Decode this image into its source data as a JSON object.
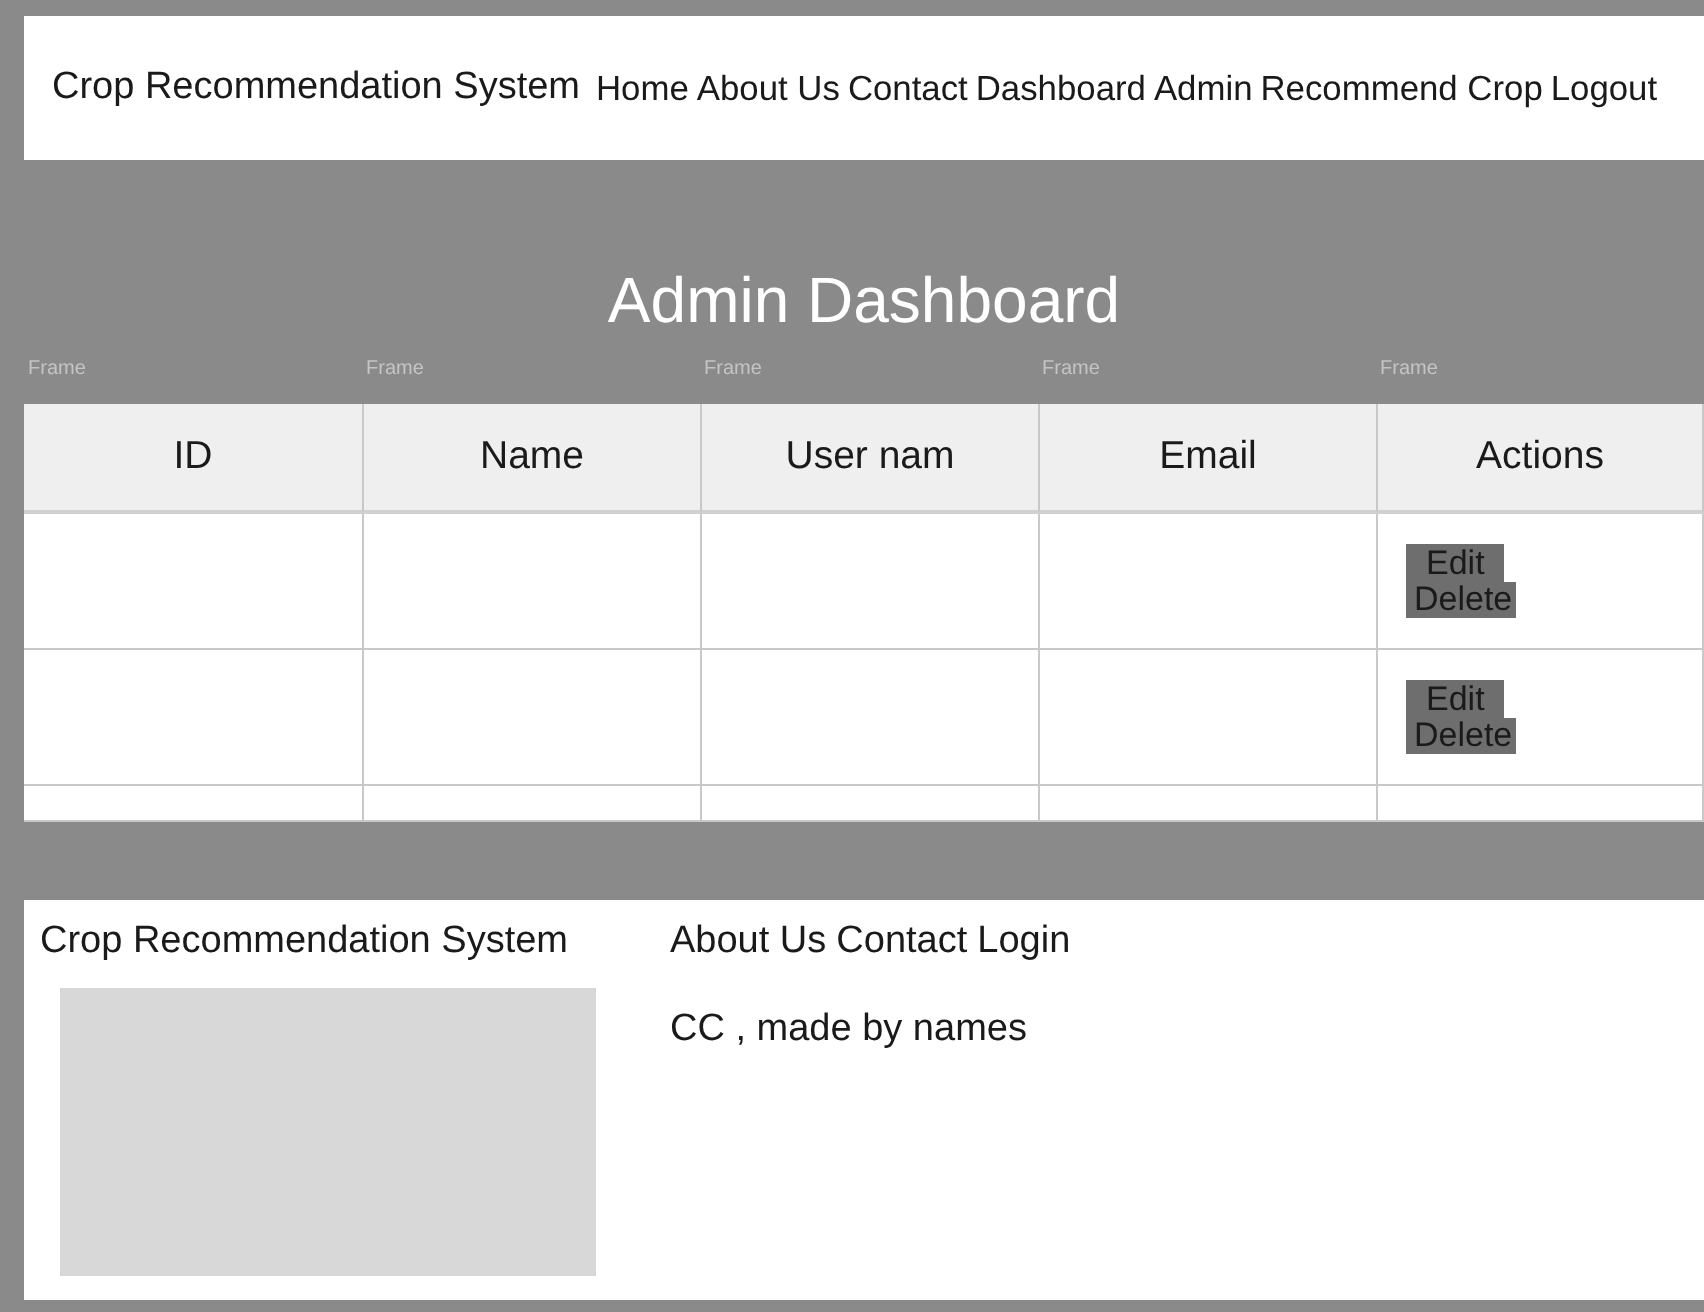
{
  "header": {
    "brand": "Crop Recommendation System",
    "nav": [
      "Home",
      "About Us",
      "Contact",
      "Dashboard",
      "Admin",
      "Recommend Crop",
      "Logout"
    ]
  },
  "title": "Admin Dashboard",
  "frame_labels": [
    "Frame",
    "Frame",
    "Frame",
    "Frame",
    "Frame"
  ],
  "table": {
    "columns": [
      "ID",
      "Name",
      "User nam",
      "Email",
      "Actions"
    ],
    "rows": [
      {
        "actions": [
          "Edit",
          "Delete"
        ]
      },
      {
        "actions": [
          "Edit",
          "Delete"
        ]
      },
      {}
    ]
  },
  "footer": {
    "brand": "Crop Recommendation System",
    "links": [
      "About Us",
      "Contact",
      "Login"
    ],
    "credit": "CC , made by names"
  }
}
